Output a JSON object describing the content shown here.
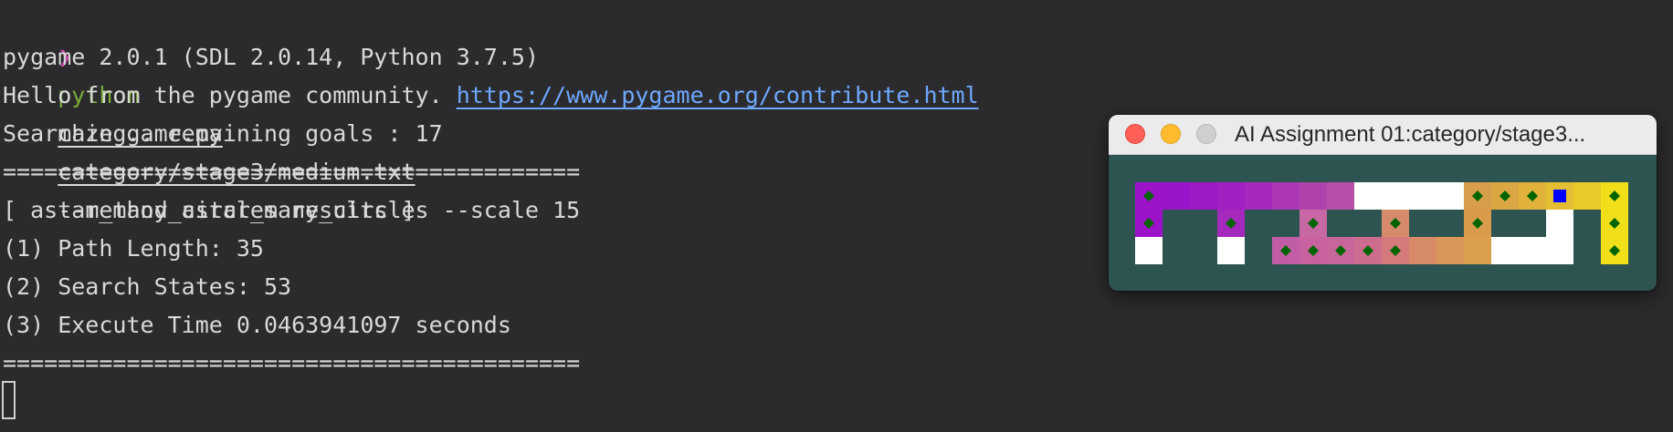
{
  "terminal": {
    "prompt_symbol": "❯",
    "command": {
      "program": "python",
      "script": "maze_game.py",
      "maze_file": "category/stage3/medium.txt",
      "options": "--method astar_many_circles --scale 15"
    },
    "output": {
      "pygame_version": "pygame 2.0.1 (SDL 2.0.14, Python 3.7.5)",
      "hello_text": "Hello from the pygame community. ",
      "hello_link": "https://www.pygame.org/contribute.html",
      "searching": "Searching.. remaining goals : 17",
      "separator_top": "==========================================",
      "results_header": "[ astar_many_circles results ]",
      "path_length": "(1) Path Length: 35",
      "search_states": "(2) Search States: 53",
      "execute_time": "(3) Execute Time 0.0463941097 seconds",
      "separator_bottom": "=========================================="
    }
  },
  "pygame_window": {
    "title": "AI Assignment 01:category/stage3...",
    "background_color": "#2e5451",
    "maze": {
      "columns": 18,
      "rows": 3,
      "wall_color": "#2e5451",
      "open_color": "#ffffff",
      "goal_marker_color": "#006400",
      "agent_color": "#0000ff",
      "cells": [
        [
          "#9b12c9",
          "#9a14c9",
          "#9c1ac6",
          "#a21fc1",
          "#a529bc",
          "#ab37b4",
          "#b042ab",
          "#b84fa8",
          "#ffffff",
          "#ffffff",
          "#ffffff",
          "#ffffff",
          "#d79d4a",
          "#dba743",
          "#e0b13b",
          "#e4be33",
          "#e9cb2a",
          "#f1df19"
        ],
        [
          "#9b12c9",
          "wall",
          "wall",
          "#a529bc",
          "wall",
          "wall",
          "#c767a3",
          "wall",
          "wall",
          "#d88a6d",
          "wall",
          "wall",
          "#d99b4b",
          "wall",
          "wall",
          "#ffffff",
          "wall",
          "#f1df19"
        ],
        [
          "#ffffff",
          "wall",
          "wall",
          "#ffffff",
          "wall",
          "#c15da6",
          "#c7629f",
          "#c7669a",
          "#cc6d8f",
          "#d47a7d",
          "#d88b69",
          "#da975a",
          "#db9e4d",
          "#ffffff",
          "#ffffff",
          "#ffffff",
          "wall",
          "#f1df19"
        ]
      ],
      "goals": [
        [
          0,
          0
        ],
        [
          0,
          1
        ],
        [
          3,
          1
        ],
        [
          6,
          1
        ],
        [
          9,
          1
        ],
        [
          12,
          0
        ],
        [
          12,
          1
        ],
        [
          13,
          0
        ],
        [
          14,
          0
        ],
        [
          17,
          0
        ],
        [
          17,
          1
        ],
        [
          17,
          2
        ],
        [
          5,
          2
        ],
        [
          6,
          2
        ],
        [
          7,
          2
        ],
        [
          8,
          2
        ],
        [
          9,
          2
        ]
      ],
      "agent": [
        15,
        0
      ]
    }
  }
}
